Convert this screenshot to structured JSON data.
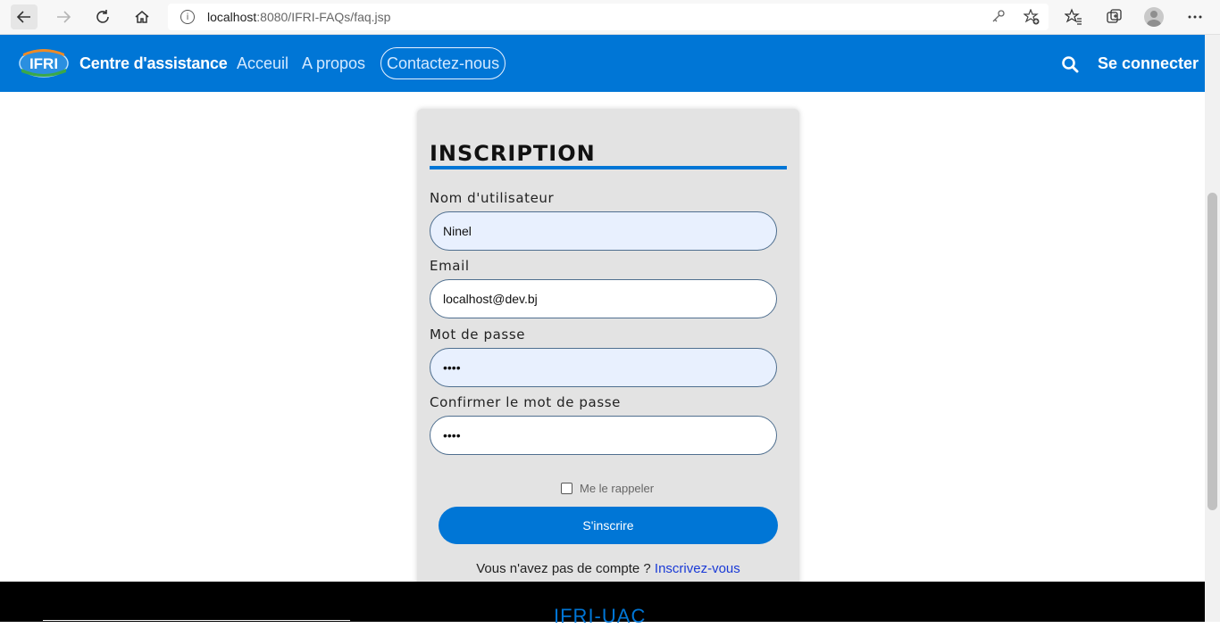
{
  "browser": {
    "url_host": "localhost",
    "url_rest": ":8080/IFRI-FAQs/faq.jsp"
  },
  "header": {
    "brand": "Centre d'assistance",
    "nav": [
      "Acceuil",
      "A propos",
      "Contactez-nous"
    ],
    "login": "Se connecter",
    "logo_text": "IFRI",
    "accent_color": "#0076d6"
  },
  "form": {
    "title": "INSCRIPTION",
    "username_label": "Nom d'utilisateur",
    "username_value": "Ninel",
    "email_label": "Email",
    "email_value": "localhost@dev.bj",
    "password_label": "Mot de passe",
    "password_value": "••••",
    "confirm_label": "Confirmer le mot de passe",
    "confirm_value": "••••",
    "remember_label": "Me le rappeler",
    "submit_label": "S'inscrire",
    "signup_prompt": "Vous n'avez pas de compte ? ",
    "signup_link": "Inscrivez-vous"
  },
  "footer": {
    "title": "IFRI-UAC"
  },
  "icons": {
    "back": "arrow-left-icon",
    "forward": "arrow-right-icon",
    "reload": "reload-icon",
    "home": "home-icon",
    "info": "info-icon",
    "key": "key-icon",
    "favorite_add": "star-plus-icon",
    "favorites": "favorites-icon",
    "collections": "collections-icon",
    "profile": "avatar",
    "menu": "more-icon",
    "search": "search-icon"
  }
}
